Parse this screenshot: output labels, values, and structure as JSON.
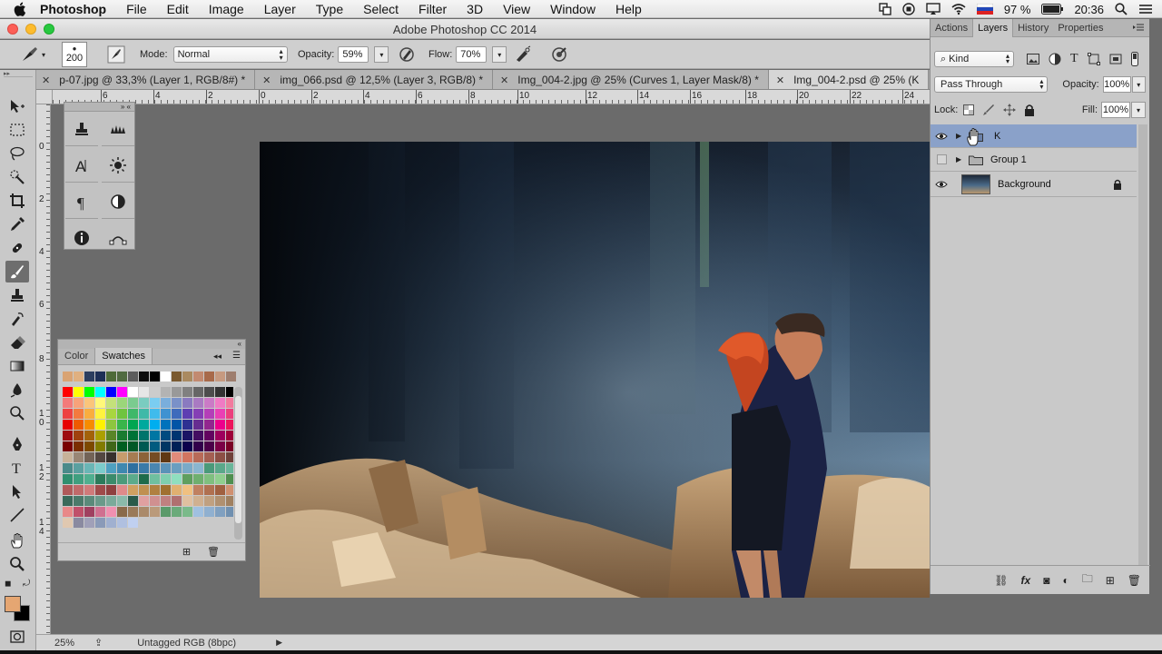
{
  "menubar": {
    "app_name": "Photoshop",
    "items": [
      "File",
      "Edit",
      "Image",
      "Layer",
      "Type",
      "Select",
      "Filter",
      "3D",
      "View",
      "Window",
      "Help"
    ],
    "battery": "97 %",
    "time": "20:36"
  },
  "window": {
    "title": "Adobe Photoshop CC 2014"
  },
  "options": {
    "brush_size": "200",
    "mode_label": "Mode:",
    "mode_value": "Normal",
    "opacity_label": "Opacity:",
    "opacity_value": "59%",
    "flow_label": "Flow:",
    "flow_value": "70%"
  },
  "doc_tabs": [
    {
      "label": "p-07.jpg @ 33,3% (Layer 1, RGB/8#) *"
    },
    {
      "label": "img_066.psd @ 12,5% (Layer 3, RGB/8) *"
    },
    {
      "label": "Img_004-2.jpg @ 25% (Curves 1, Layer Mask/8) *"
    },
    {
      "label": "Img_004-2.psd @ 25% (K"
    }
  ],
  "ruler": {
    "top_ticks": [
      "6",
      "4",
      "2",
      "0",
      "2",
      "4",
      "6",
      "8",
      "10",
      "12",
      "14",
      "16",
      "18",
      "20",
      "22",
      "24"
    ],
    "left_ticks": [
      "0",
      "2",
      "4",
      "6",
      "8",
      "1\n0",
      "1\n2",
      "1\n4"
    ]
  },
  "swatches_panel": {
    "tabs": [
      "Color",
      "Swatches"
    ],
    "active_tab": "Swatches",
    "recent": [
      "#d9a373",
      "#e0b080",
      "#2c3e5f",
      "#1d2f56",
      "#4e6b38",
      "#506a40",
      "#5c5c5c",
      "#0c0c0c",
      "#000000",
      "#ffffff",
      "#7a5a30",
      "#aa8a60",
      "#c28a70",
      "#a86a4a",
      "#c69a80",
      "#9e7e6e"
    ],
    "grid": [
      "#ff0000",
      "#ffff00",
      "#00ff00",
      "#00ffff",
      "#0000ff",
      "#ff00ff",
      "#ffffff",
      "#e6e6e6",
      "#cccccc",
      "#b3b3b3",
      "#999999",
      "#808080",
      "#666666",
      "#4d4d4d",
      "#333333",
      "#000000",
      "#f37a7a",
      "#f7a27a",
      "#fbc57a",
      "#fff87a",
      "#c4e17a",
      "#9bd67a",
      "#7acb8f",
      "#7accc0",
      "#7acdf1",
      "#7aaedc",
      "#7a91c8",
      "#8a7ac0",
      "#a97ac2",
      "#cb7ac6",
      "#f07ac4",
      "#f27a9e",
      "#ee4242",
      "#f37a3f",
      "#f9ad3f",
      "#fff33f",
      "#a8d63f",
      "#6fc43f",
      "#3fb86a",
      "#3fb9a8",
      "#3fbbec",
      "#3f92d1",
      "#3f6bbc",
      "#5e3fb2",
      "#853fb5",
      "#b43fb8",
      "#ea3fb5",
      "#ec3f7d",
      "#e60000",
      "#ee5a00",
      "#f68c00",
      "#fff200",
      "#8dc63f",
      "#39b54a",
      "#00a651",
      "#00a99d",
      "#00aeef",
      "#0072bc",
      "#0054a6",
      "#2e3192",
      "#662d91",
      "#92278f",
      "#ec008c",
      "#ed145b",
      "#9e0b0f",
      "#a0410d",
      "#a36209",
      "#aba000",
      "#598527",
      "#197b30",
      "#007236",
      "#00746b",
      "#0076a3",
      "#004a80",
      "#003471",
      "#1b1464",
      "#440e62",
      "#630460",
      "#9e005d",
      "#9e0039",
      "#790000",
      "#7b2e00",
      "#7d4900",
      "#827b00",
      "#406618",
      "#005e20",
      "#005826",
      "#005952",
      "#005b7f",
      "#003663",
      "#002157",
      "#0d004c",
      "#32004b",
      "#4b0049",
      "#7b0046",
      "#7a0026",
      "#c7b299",
      "#998675",
      "#736357",
      "#534741",
      "#37302d",
      "#c69c6d",
      "#a67c52",
      "#8c6239",
      "#754c24",
      "#603813",
      "#e08b7a",
      "#d27560",
      "#b86a58",
      "#a45f52",
      "#8d4f45",
      "#70413a",
      "#4a8a8a",
      "#5aa0a0",
      "#6ab6b6",
      "#7ccccc",
      "#4ea0c0",
      "#3e88b0",
      "#2e70a0",
      "#3a7aa8",
      "#4a86b0",
      "#5a92b8",
      "#6a9ec0",
      "#7aaac8",
      "#8ab6d0",
      "#4a9a7a",
      "#5aa88a",
      "#6ab69a",
      "#2f8f6f",
      "#3f9f7f",
      "#4faf8f",
      "#2b7b5b",
      "#3b8b6b",
      "#4b9b7b",
      "#5bab8b",
      "#1f6b4b",
      "#6fbf9f",
      "#7fcfaf",
      "#8fdfbf",
      "#5f9f5f",
      "#6faf6f",
      "#7fbf7f",
      "#8fcf8f",
      "#4f8f4f",
      "#b05a5a",
      "#c06a6a",
      "#d07a7a",
      "#a04a4a",
      "#904040",
      "#e08a8a",
      "#d0a060",
      "#c09050",
      "#b08040",
      "#a07030",
      "#e0b070",
      "#f0c080",
      "#c08060",
      "#b07050",
      "#a06040",
      "#d09070",
      "#3a6a5a",
      "#4a7a6a",
      "#5a8a7a",
      "#6a9a8a",
      "#7aaa9a",
      "#8abaaa",
      "#2a5a4a",
      "#e0a0a0",
      "#d09090",
      "#c08080",
      "#b07070",
      "#e0c0a0",
      "#d0b090",
      "#c0a080",
      "#b09070",
      "#a08060",
      "#e88888",
      "#c0506a",
      "#a04060",
      "#d07090",
      "#f090b0",
      "#8a6a4a",
      "#9a7a5a",
      "#aa8a6a",
      "#ba9a7a",
      "#5a9a6a",
      "#6aaa7a",
      "#7aba8a",
      "#a0c0e0",
      "#90b0d0",
      "#80a0c0",
      "#7090b0",
      "#e0c8b0",
      "#8a8aa0",
      "#a0a0b8",
      "#8a9ab8",
      "#a0b0d0",
      "#b0c0e0",
      "#c0d0f0"
    ]
  },
  "layers_panel": {
    "tabs": [
      "Actions",
      "Layers",
      "History",
      "Properties"
    ],
    "active_tab": "Layers",
    "kind_label": "Kind",
    "blend_mode": "Pass Through",
    "opacity_label": "Opacity:",
    "opacity_value": "100%",
    "lock_label": "Lock:",
    "fill_label": "Fill:",
    "fill_value": "100%",
    "layers": [
      {
        "name": "K",
        "type": "group",
        "visible": true,
        "selected": true
      },
      {
        "name": "Group 1",
        "type": "group",
        "visible": false,
        "selected": false
      },
      {
        "name": "Background",
        "type": "pixel",
        "visible": true,
        "selected": false,
        "locked": true
      }
    ]
  },
  "status": {
    "zoom": "25%",
    "profile": "Untagged RGB (8bpc)"
  },
  "colors": {
    "foreground": "#e5a672",
    "background": "#000000",
    "selected_layer": "#8aa1c9"
  }
}
